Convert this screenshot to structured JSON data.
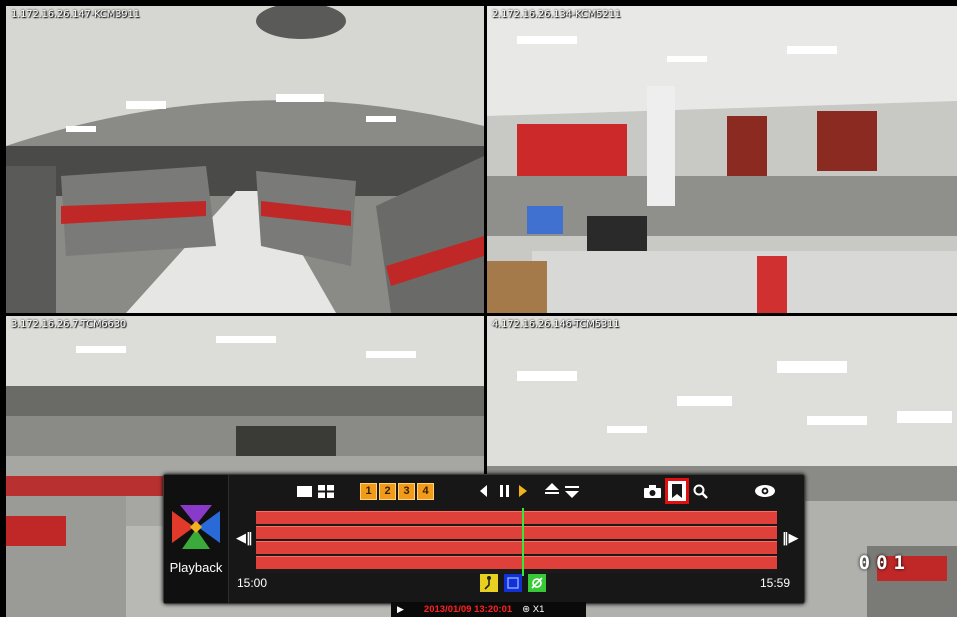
{
  "cameras": [
    {
      "label": "1.172.16.26.147-KCM3911"
    },
    {
      "label": "2.172.16.26.134-KCM5211"
    },
    {
      "label": "3.172.16.26.7-TCM6630"
    },
    {
      "label": "4.172.16.26.146-TCM5311"
    }
  ],
  "channel_display": "001",
  "panel": {
    "logo_label": "Playback",
    "channel_buttons": [
      "1",
      "2",
      "3",
      "4"
    ],
    "time_start": "15:00",
    "time_end": "15:59",
    "icons": {
      "layout_single": "single-view-icon",
      "layout_quad": "quad-view-icon",
      "rewind": "step-back-icon",
      "pause": "pause-icon",
      "forward": "play-forward-icon",
      "speed_up": "speed-up-icon",
      "speed_down": "speed-down-icon",
      "snapshot": "camera-icon",
      "bookmark": "bookmark-icon",
      "search": "search-icon",
      "eye": "eye-icon",
      "motion_event": "motion-event-icon",
      "all_event": "all-event-icon",
      "sensor_event": "sensor-event-icon"
    },
    "colors": {
      "track": "#e0403a",
      "cursor": "#38e638",
      "channel_button": "#f09b1a",
      "highlight": "#e01010"
    },
    "tracks_count_label": "",
    "cursor_position_fraction": 0.51
  },
  "status": {
    "datetime": "2013/01/09 13:20:01",
    "speed": "X1"
  }
}
